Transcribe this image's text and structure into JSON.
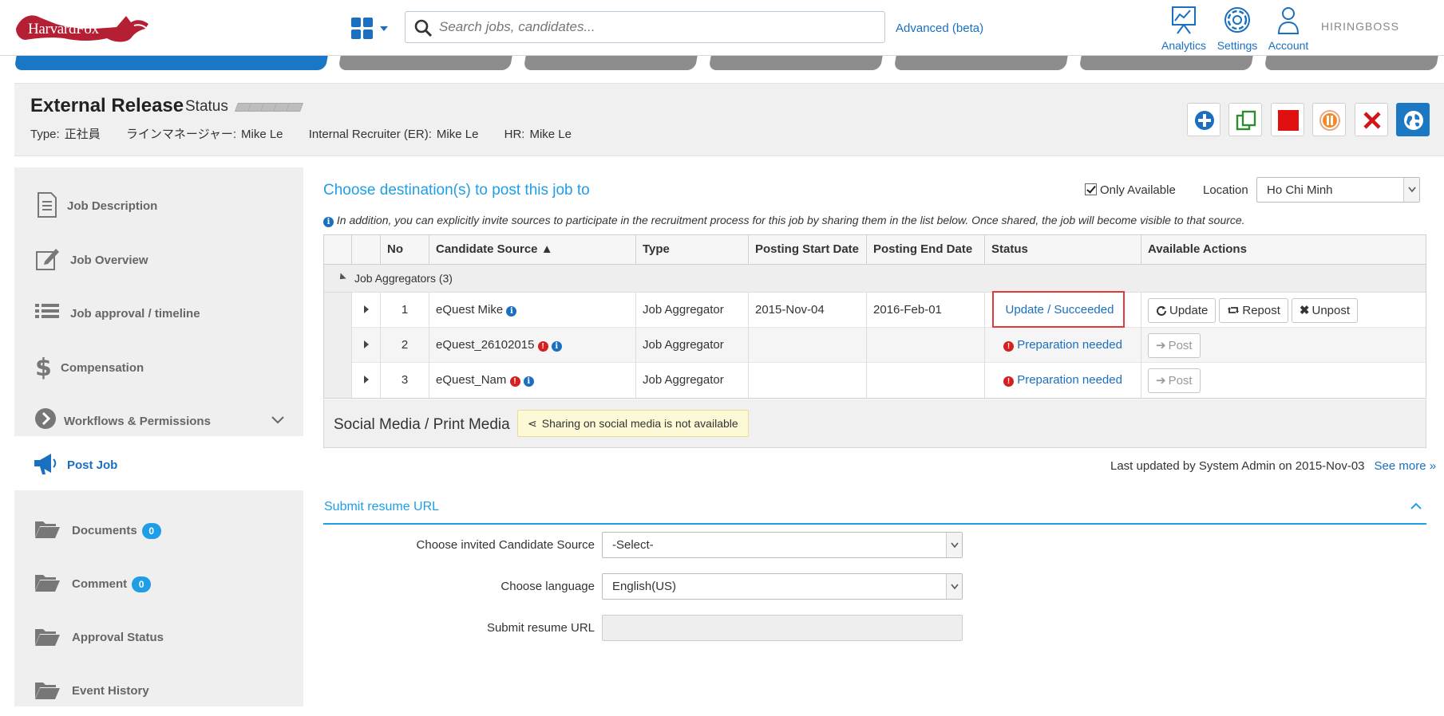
{
  "brand": {
    "name": "HarvardFox",
    "product_logo": "HIRINGBOSS"
  },
  "search": {
    "placeholder": "Search jobs, candidates...",
    "advanced_label": "Advanced (beta)"
  },
  "topnav": [
    {
      "label": "Analytics",
      "icon": "analytics-icon"
    },
    {
      "label": "Settings",
      "icon": "gear-icon"
    },
    {
      "label": "Account",
      "icon": "account-icon"
    }
  ],
  "job": {
    "title": "External Release",
    "status_label": "Status",
    "status_level": 0,
    "meta": [
      {
        "key": "Type:",
        "value": "正社員"
      },
      {
        "key": "ラインマネージャー:",
        "value": "Mike Le"
      },
      {
        "key": "Internal Recruiter (ER):",
        "value": "Mike Le"
      },
      {
        "key": "HR:",
        "value": "Mike Le"
      }
    ],
    "tools": [
      "add-icon",
      "copy-icon",
      "stop-icon",
      "pause-icon",
      "close-icon",
      "globe-icon"
    ]
  },
  "sidebar": {
    "items": [
      {
        "label": "Job Description",
        "icon": "document-icon"
      },
      {
        "label": "Job Overview",
        "icon": "edit-icon"
      },
      {
        "label": "Job approval / timeline",
        "icon": "list-icon"
      },
      {
        "label": "Compensation",
        "icon": "dollar-icon"
      },
      {
        "label": "Workflows & Permissions",
        "icon": "arrow-circle-icon"
      },
      {
        "label": "Post Job",
        "icon": "megaphone-icon"
      },
      {
        "label": "Documents",
        "icon": "folder-icon",
        "badge": "0"
      },
      {
        "label": "Comment",
        "icon": "folder-icon",
        "badge": "0"
      },
      {
        "label": "Approval Status",
        "icon": "folder-icon"
      },
      {
        "label": "Event History",
        "icon": "folder-icon"
      }
    ]
  },
  "post": {
    "heading": "Choose destination(s) to post this job to",
    "only_available_label": "Only Available",
    "only_available_checked": true,
    "location_label": "Location",
    "location_value": "Ho Chi Minh",
    "info_text": "In addition, you can explicitly invite sources to participate in the recruitment process for this job by sharing them in the list below. Once shared, the job will become visible to that source.",
    "columns": [
      "No",
      "Candidate Source ▲",
      "Type",
      "Posting Start Date",
      "Posting End Date",
      "Status",
      "Available Actions"
    ],
    "group_label": "Job Aggregators (3)",
    "rows": [
      {
        "no": "1",
        "source": "eQuest Mike",
        "type": "Job Aggregator",
        "start": "2015-Nov-04",
        "end": "2016-Feb-01",
        "status": "Update / Succeeded",
        "actions": [
          "Update",
          "Repost",
          "Unpost"
        ]
      },
      {
        "no": "2",
        "source": "eQuest_26102015",
        "type": "Job Aggregator",
        "start": "",
        "end": "",
        "status": "Preparation needed",
        "actions": [
          "Post"
        ]
      },
      {
        "no": "3",
        "source": "eQuest_Nam",
        "type": "Job Aggregator",
        "start": "",
        "end": "",
        "status": "Preparation needed",
        "actions": [
          "Post"
        ]
      }
    ],
    "social_title": "Social Media / Print Media",
    "social_note": "Sharing on social media is not available",
    "last_updated": "Last updated by System Admin on 2015-Nov-03",
    "see_more": "See more »"
  },
  "submit": {
    "section_title": "Submit resume URL",
    "source_label": "Choose invited Candidate Source",
    "source_value": "-Select-",
    "language_label": "Choose language",
    "language_value": "English(US)",
    "url_label": "Submit resume URL",
    "url_value": ""
  },
  "colors": {
    "accent": "#1e9ee6",
    "link": "#1a6fc0",
    "danger": "#d61f1f",
    "highlight_box": "#e03a3a"
  }
}
